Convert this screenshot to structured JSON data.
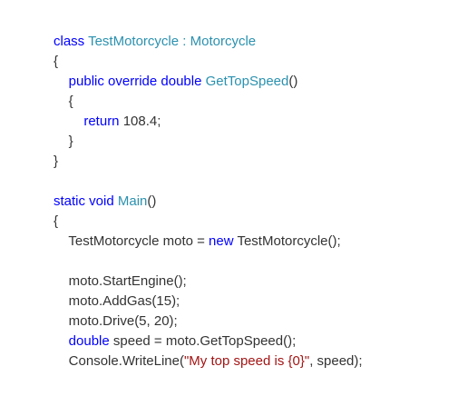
{
  "code": {
    "colors": {
      "keyword": "#0000ff",
      "type": "#2b91af",
      "plain": "#333333",
      "string": "#a31515"
    },
    "lines": [
      {
        "indent": "",
        "tokens": [
          {
            "t": "class ",
            "k": "kw"
          },
          {
            "t": "TestMotorcycle : Motorcycle",
            "k": "type"
          }
        ]
      },
      {
        "indent": "",
        "tokens": [
          {
            "t": "{",
            "k": "plain"
          }
        ]
      },
      {
        "indent": "    ",
        "tokens": [
          {
            "t": "public override double ",
            "k": "kw"
          },
          {
            "t": "GetTopSpeed",
            "k": "type"
          },
          {
            "t": "()",
            "k": "plain"
          }
        ]
      },
      {
        "indent": "    ",
        "tokens": [
          {
            "t": "{",
            "k": "plain"
          }
        ]
      },
      {
        "indent": "        ",
        "tokens": [
          {
            "t": "return ",
            "k": "kw"
          },
          {
            "t": "108.4;",
            "k": "plain"
          }
        ]
      },
      {
        "indent": "    ",
        "tokens": [
          {
            "t": "}",
            "k": "plain"
          }
        ]
      },
      {
        "indent": "",
        "tokens": [
          {
            "t": "}",
            "k": "plain"
          }
        ]
      },
      {
        "indent": "",
        "tokens": []
      },
      {
        "indent": "",
        "tokens": [
          {
            "t": "static void ",
            "k": "kw"
          },
          {
            "t": "Main",
            "k": "type"
          },
          {
            "t": "()",
            "k": "plain"
          }
        ]
      },
      {
        "indent": "",
        "tokens": [
          {
            "t": "{",
            "k": "plain"
          }
        ]
      },
      {
        "indent": "    ",
        "tokens": [
          {
            "t": "TestMotorcycle moto = ",
            "k": "plain"
          },
          {
            "t": "new ",
            "k": "kw"
          },
          {
            "t": "TestMotorcycle();",
            "k": "plain"
          }
        ]
      },
      {
        "indent": "",
        "tokens": []
      },
      {
        "indent": "    ",
        "tokens": [
          {
            "t": "moto.StartEngine();",
            "k": "plain"
          }
        ]
      },
      {
        "indent": "    ",
        "tokens": [
          {
            "t": "moto.AddGas(15);",
            "k": "plain"
          }
        ]
      },
      {
        "indent": "    ",
        "tokens": [
          {
            "t": "moto.Drive(5, 20);",
            "k": "plain"
          }
        ]
      },
      {
        "indent": "    ",
        "tokens": [
          {
            "t": "double ",
            "k": "kw"
          },
          {
            "t": "speed = moto.GetTopSpeed();",
            "k": "plain"
          }
        ]
      },
      {
        "indent": "    ",
        "tokens": [
          {
            "t": "Console.WriteLine(",
            "k": "plain"
          },
          {
            "t": "\"My top speed is {0}\"",
            "k": "str"
          },
          {
            "t": ", speed);",
            "k": "plain"
          }
        ]
      }
    ]
  }
}
